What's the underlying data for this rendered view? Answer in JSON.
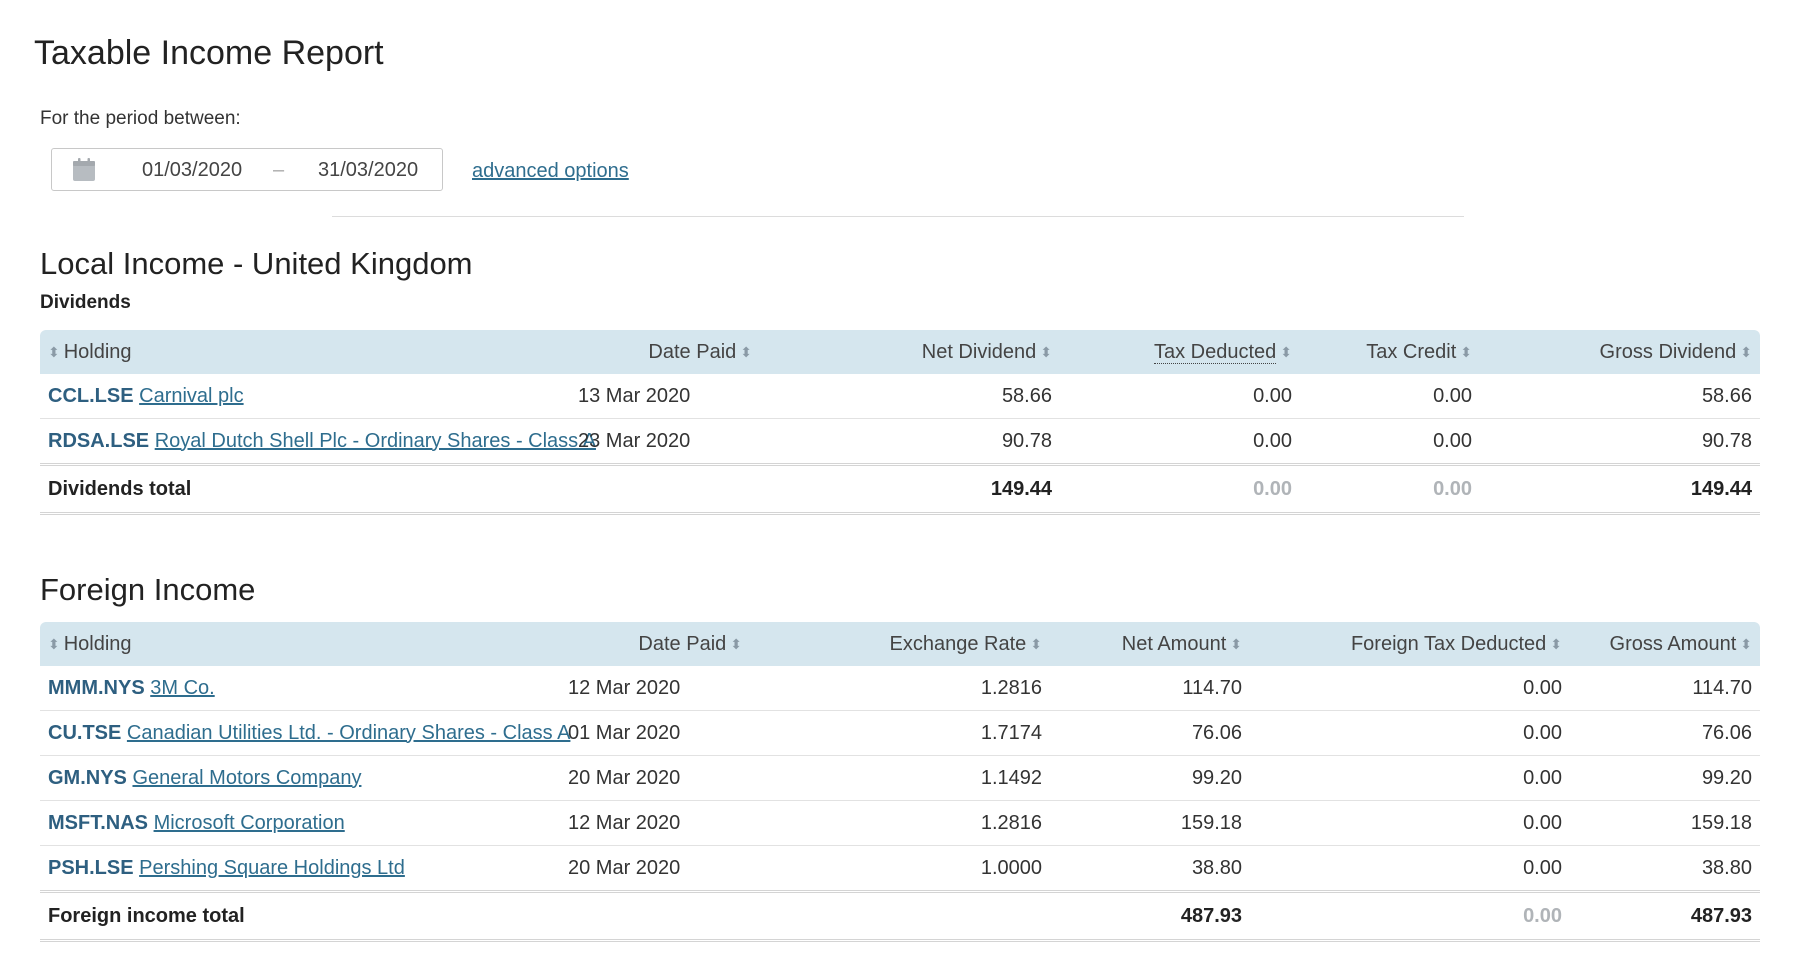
{
  "title": "Taxable Income Report",
  "period": {
    "label": "For the period between:",
    "from": "01/03/2020",
    "separator": "–",
    "to": "31/03/2020",
    "advanced_label": "advanced options"
  },
  "local": {
    "heading": "Local Income - United Kingdom",
    "subheading": "Dividends",
    "columns": {
      "holding": "Holding",
      "date_paid": "Date Paid",
      "net": "Net Dividend",
      "tax_deducted": "Tax Deducted",
      "tax_credit": "Tax Credit",
      "gross": "Gross Dividend"
    },
    "rows": [
      {
        "symbol": "CCL.LSE",
        "name": "Carnival plc",
        "date": "13 Mar 2020",
        "net": "58.66",
        "tax_deducted": "0.00",
        "tax_credit": "0.00",
        "gross": "58.66"
      },
      {
        "symbol": "RDSA.LSE",
        "name": "Royal Dutch Shell Plc - Ordinary Shares - Class A",
        "date": "23 Mar 2020",
        "net": "90.78",
        "tax_deducted": "0.00",
        "tax_credit": "0.00",
        "gross": "90.78"
      }
    ],
    "total": {
      "label": "Dividends total",
      "net": "149.44",
      "tax_deducted": "0.00",
      "tax_credit": "0.00",
      "gross": "149.44"
    }
  },
  "foreign": {
    "heading": "Foreign Income",
    "columns": {
      "holding": "Holding",
      "date_paid": "Date Paid",
      "rate": "Exchange Rate",
      "net": "Net Amount",
      "foreign_tax": "Foreign Tax Deducted",
      "gross": "Gross Amount"
    },
    "rows": [
      {
        "symbol": "MMM.NYS",
        "name": "3M Co.",
        "date": "12 Mar 2020",
        "rate": "1.2816",
        "net": "114.70",
        "foreign_tax": "0.00",
        "gross": "114.70"
      },
      {
        "symbol": "CU.TSE",
        "name": "Canadian Utilities Ltd. - Ordinary Shares - Class A",
        "date": "01 Mar 2020",
        "rate": "1.7174",
        "net": "76.06",
        "foreign_tax": "0.00",
        "gross": "76.06"
      },
      {
        "symbol": "GM.NYS",
        "name": "General Motors Company",
        "date": "20 Mar 2020",
        "rate": "1.1492",
        "net": "99.20",
        "foreign_tax": "0.00",
        "gross": "99.20"
      },
      {
        "symbol": "MSFT.NAS",
        "name": "Microsoft Corporation",
        "date": "12 Mar 2020",
        "rate": "1.2816",
        "net": "159.18",
        "foreign_tax": "0.00",
        "gross": "159.18"
      },
      {
        "symbol": "PSH.LSE",
        "name": "Pershing Square Holdings Ltd",
        "date": "20 Mar 2020",
        "rate": "1.0000",
        "net": "38.80",
        "foreign_tax": "0.00",
        "gross": "38.80"
      }
    ],
    "total": {
      "label": "Foreign income total",
      "net": "487.93",
      "foreign_tax": "0.00",
      "gross": "487.93"
    }
  },
  "colors": {
    "header_bg": "#d5e6ee",
    "link": "#2e6d8e",
    "symbol": "#2e5f80",
    "muted": "#b0b4b8"
  },
  "icons": {
    "calendar": "calendar-icon",
    "sort": "sort-icon"
  }
}
